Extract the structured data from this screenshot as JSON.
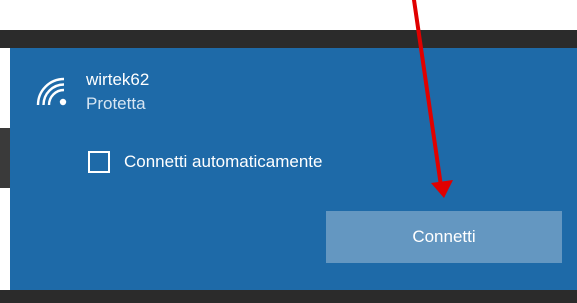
{
  "network": {
    "ssid": "wirtek62",
    "security": "Protetta",
    "icon": "wifi-secured-icon"
  },
  "auto_connect": {
    "label": "Connetti automaticamente",
    "checked": false
  },
  "connect_button": {
    "label": "Connetti"
  },
  "annotation": {
    "icon": "red-arrow-annotation",
    "color": "#e00000"
  },
  "colors": {
    "panel_bg": "#1e6aa8",
    "button_bg": "#6497c1",
    "taskbar_dark": "#2b2b2b"
  }
}
